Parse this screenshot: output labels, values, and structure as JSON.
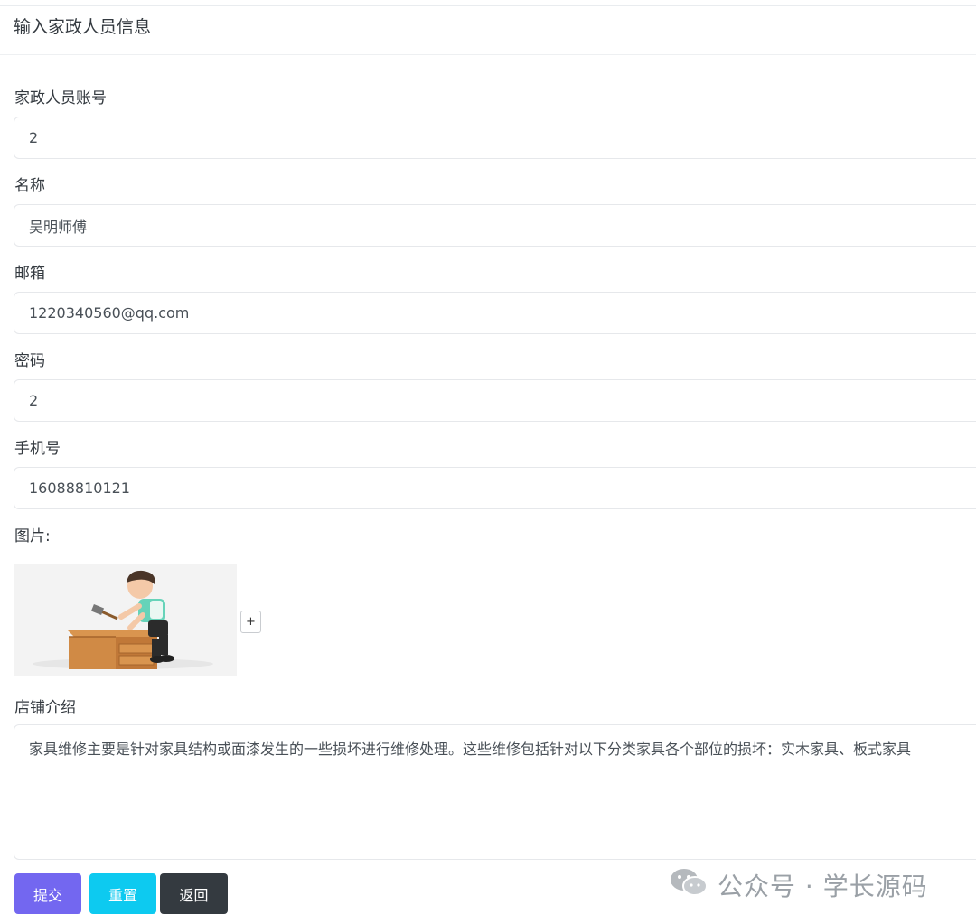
{
  "header": {
    "title": "输入家政人员信息"
  },
  "form": {
    "account": {
      "label": "家政人员账号",
      "value": "2"
    },
    "name": {
      "label": "名称",
      "value": "吴明师傅"
    },
    "email": {
      "label": "邮箱",
      "value": "1220340560@qq.com"
    },
    "password": {
      "label": "密码",
      "value": "2"
    },
    "phone": {
      "label": "手机号",
      "value": "16088810121"
    },
    "image": {
      "label": "图片:",
      "add_label": "+"
    },
    "intro": {
      "label": "店铺介绍",
      "value": "家具维修主要是针对家具结构或面漆发生的一些损坏进行维修处理。这些维修包括针对以下分类家具各个部位的损坏：实木家具、板式家具"
    }
  },
  "buttons": {
    "submit": "提交",
    "reset": "重置",
    "back": "返回"
  },
  "watermark": {
    "text": "公众号 · 学长源码",
    "icon": "wechat-icon"
  },
  "colors": {
    "submit": "#7367f0",
    "reset": "#0dcaf0",
    "back": "#343a40"
  }
}
